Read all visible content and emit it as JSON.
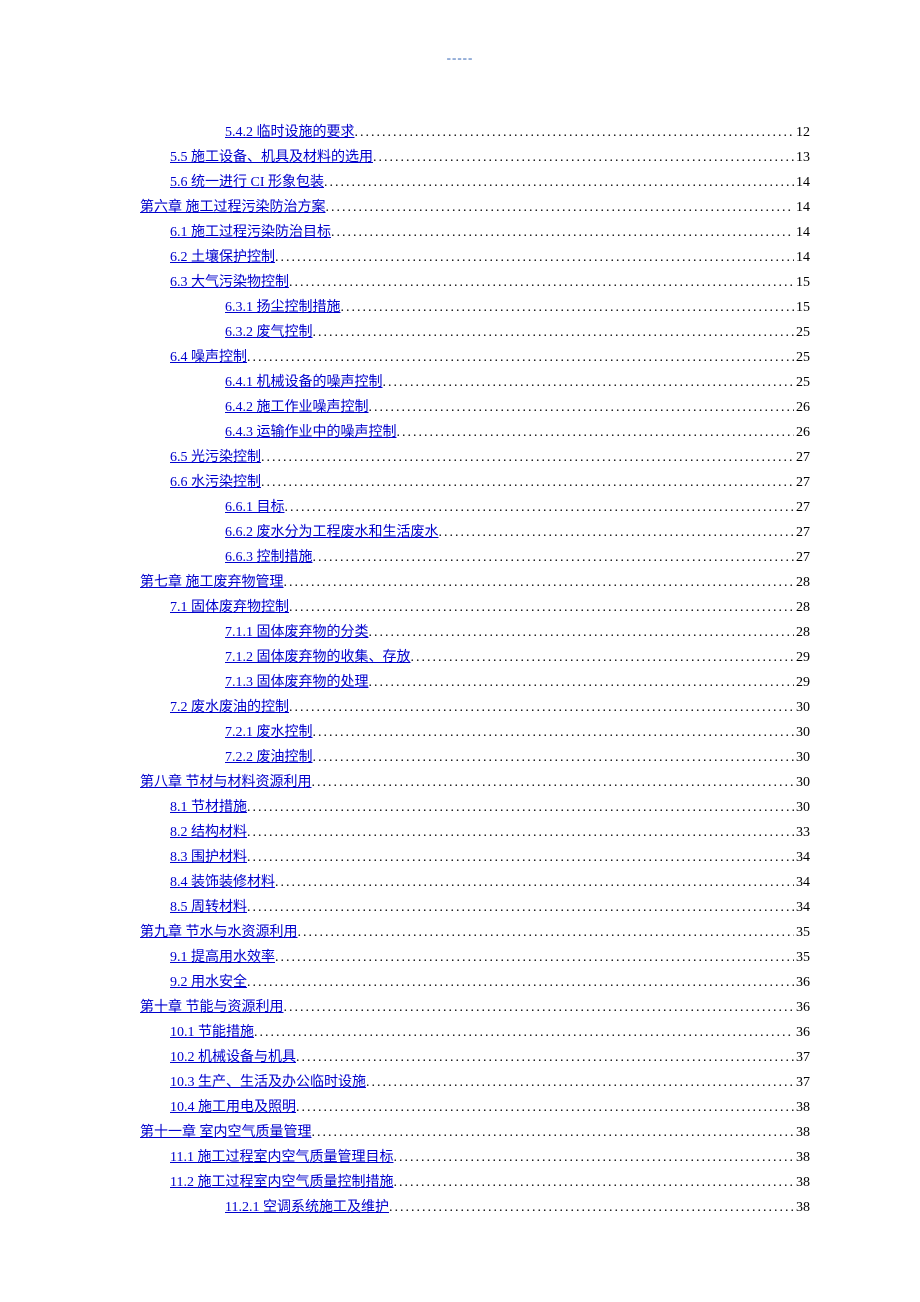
{
  "topMark": "-----",
  "toc": [
    {
      "level": 2,
      "label": "5.4.2  临时设施的要求",
      "page": "12"
    },
    {
      "level": 1,
      "label": "5.5  施工设备、机具及材料的选用",
      "page": "13"
    },
    {
      "level": 1,
      "label": "5.6  统一进行 CI 形象包装",
      "page": "14"
    },
    {
      "level": 0,
      "label": "第六章   施工过程污染防治方案",
      "page": "14"
    },
    {
      "level": 1,
      "label": "6.1  施工过程污染防治目标",
      "page": "14"
    },
    {
      "level": 1,
      "label": "6.2  土壤保护控制",
      "page": "14"
    },
    {
      "level": 1,
      "label": "6.3  大气污染物控制",
      "page": "15"
    },
    {
      "level": 2,
      "label": "6.3.1  扬尘控制措施",
      "page": "15"
    },
    {
      "level": 2,
      "label": "6.3.2  废气控制",
      "page": "25"
    },
    {
      "level": 1,
      "label": "6.4  噪声控制",
      "page": "25"
    },
    {
      "level": 2,
      "label": "6.4.1  机械设备的噪声控制",
      "page": "25"
    },
    {
      "level": 2,
      "label": "6.4.2  施工作业噪声控制",
      "page": "26"
    },
    {
      "level": 2,
      "label": "6.4.3  运输作业中的噪声控制",
      "page": "26"
    },
    {
      "level": 1,
      "label": "6.5  光污染控制",
      "page": "27"
    },
    {
      "level": 1,
      "label": "6.6  水污染控制",
      "page": "27"
    },
    {
      "level": 2,
      "label": "6.6.1  目标",
      "page": "27"
    },
    {
      "level": 2,
      "label": "6.6.2  废水分为工程废水和生活废水",
      "page": "27"
    },
    {
      "level": 2,
      "label": "6.6.3  控制措施",
      "page": "27"
    },
    {
      "level": 0,
      "label": "第七章  施工废弃物管理",
      "page": "28"
    },
    {
      "level": 1,
      "label": "7.1  固体废弃物控制",
      "page": "28"
    },
    {
      "level": 2,
      "label": "7.1.1  固体废弃物的分类",
      "page": "28"
    },
    {
      "level": 2,
      "label": "7.1.2  固体废弃物的收集、存放",
      "page": "29"
    },
    {
      "level": 2,
      "label": "7.1.3  固体废弃物的处理",
      "page": "29"
    },
    {
      "level": 1,
      "label": "7.2  废水废油的控制",
      "page": "30"
    },
    {
      "level": 2,
      "label": "7.2.1  废水控制",
      "page": "30"
    },
    {
      "level": 2,
      "label": "7.2.2  废油控制",
      "page": "30"
    },
    {
      "level": 0,
      "label": "第八章  节材与材料资源利用",
      "page": "30"
    },
    {
      "level": 1,
      "label": "8.1  节材措施",
      "page": "30"
    },
    {
      "level": 1,
      "label": "8.2  结构材料",
      "page": "33"
    },
    {
      "level": 1,
      "label": "8.3  围护材料",
      "page": "34"
    },
    {
      "level": 1,
      "label": "8.4  装饰装修材料",
      "page": "34"
    },
    {
      "level": 1,
      "label": "8.5  周转材料",
      "page": "34"
    },
    {
      "level": 0,
      "label": "第九章  节水与水资源利用",
      "page": "35"
    },
    {
      "level": 1,
      "label": "9.1  提高用水效率",
      "page": "35"
    },
    {
      "level": 1,
      "label": "9.2  用水安全",
      "page": "36"
    },
    {
      "level": 0,
      "label": "第十章   节能与资源利用",
      "page": "36"
    },
    {
      "level": 1,
      "label": "10.1  节能措施",
      "page": "36"
    },
    {
      "level": 1,
      "label": "10.2  机械设备与机具",
      "page": "37"
    },
    {
      "level": 1,
      "label": "10.3  生产、生活及办公临时设施",
      "page": "37"
    },
    {
      "level": 1,
      "label": "10.4  施工用电及照明",
      "page": "38"
    },
    {
      "level": 0,
      "label": "第十一章  室内空气质量管理",
      "page": "38"
    },
    {
      "level": 1,
      "label": "11.1  施工过程室内空气质量管理目标",
      "page": "38"
    },
    {
      "level": 1,
      "label": "11.2  施工过程室内空气质量控制措施",
      "page": "38"
    },
    {
      "level": 2,
      "label": "11.2.1  空调系统施工及维护",
      "page": "38"
    }
  ]
}
